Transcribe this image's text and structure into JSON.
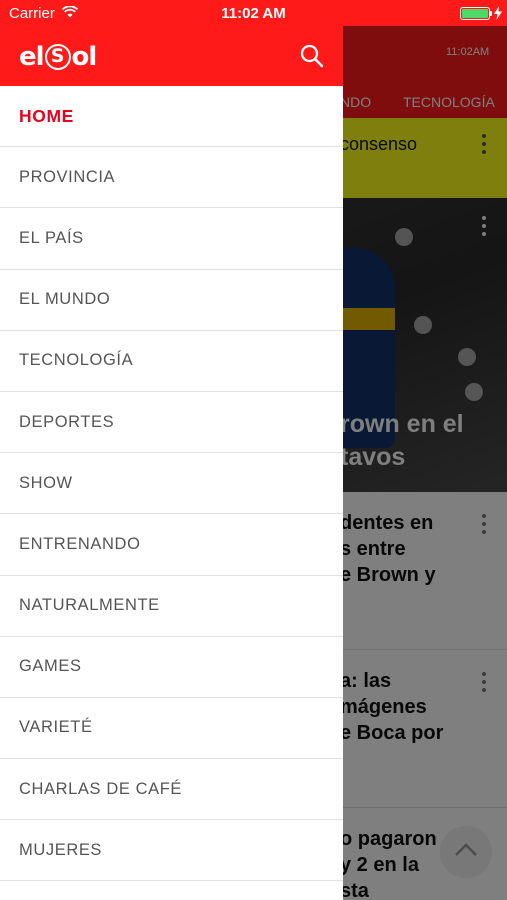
{
  "status_bar": {
    "carrier": "Carrier",
    "time": "11:02 AM"
  },
  "drawer": {
    "search_icon": "search-icon",
    "menu_items": [
      {
        "label": "HOME",
        "active": true
      },
      {
        "label": "PROVINCIA"
      },
      {
        "label": "EL PAÍS"
      },
      {
        "label": "EL MUNDO"
      },
      {
        "label": "TECNOLOGÍA"
      },
      {
        "label": "DEPORTES"
      },
      {
        "label": "SHOW"
      },
      {
        "label": "ENTRENANDO"
      },
      {
        "label": "NATURALMENTE"
      },
      {
        "label": "GAMES"
      },
      {
        "label": "VARIETÉ"
      },
      {
        "label": "CHARLAS DE CAFÉ"
      },
      {
        "label": "MUJERES"
      }
    ]
  },
  "background": {
    "header_time": "11:02AM",
    "tabs": [
      "NDO",
      "TECNOLOGÍA"
    ],
    "banner_text": "consenso",
    "photo_title": "rown en el\ntavos",
    "articles": [
      "dentes en\ns entre\ne Brown y",
      "a: las\nmágenes\ne Boca por",
      "o pagaron\ny 2 en la\nsta"
    ]
  },
  "colors": {
    "brand_red": "#ff1a1a",
    "active_red": "#e8001c",
    "banner_yellow": "#ffff1a"
  }
}
